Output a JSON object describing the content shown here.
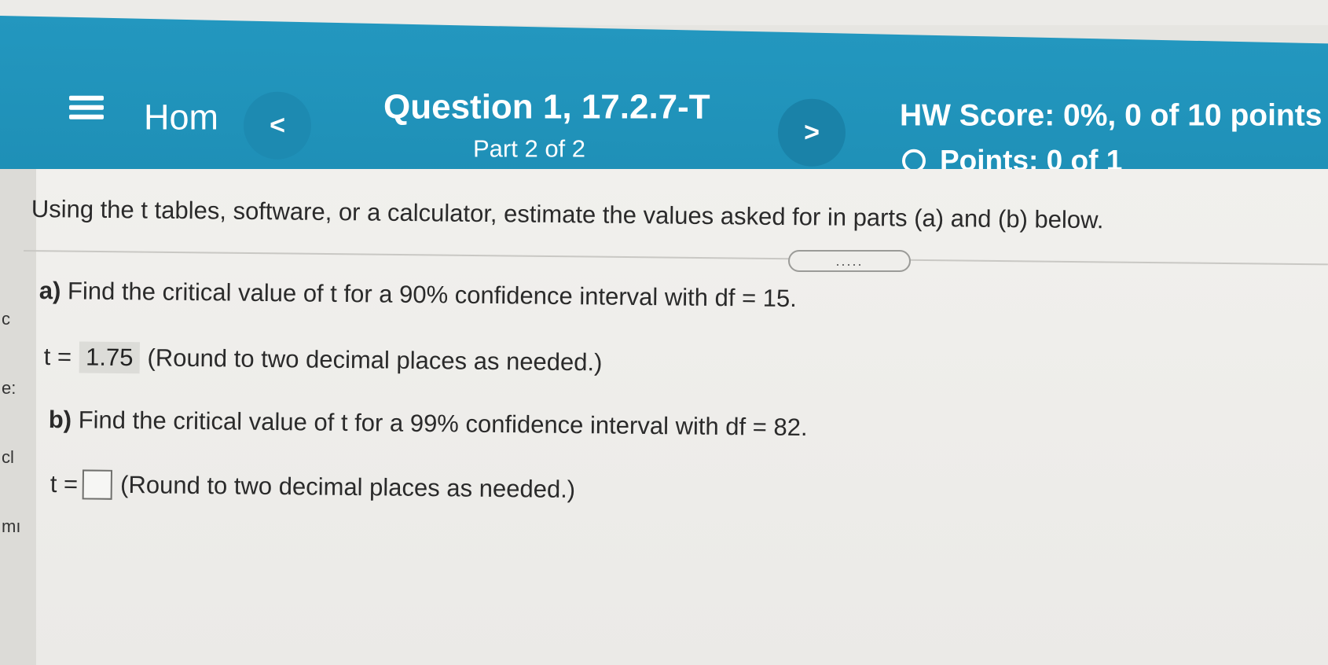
{
  "header": {
    "home_label": "Hom",
    "prev_label": "<",
    "next_label": ">",
    "question_title": "Question 1, 17.2.7-T",
    "question_part": "Part 2 of 2",
    "hw_score": "HW Score: 0%, 0 of 10 points",
    "points": "Points: 0 of 1"
  },
  "left_edge": [
    "c",
    "e:",
    "cl",
    "mı"
  ],
  "question": {
    "instructions": "Using the t tables, software, or a calculator, estimate the values asked for in parts (a) and (b) below.",
    "expand_label": ".....",
    "part_a": {
      "letter": "a)",
      "prompt": "Find the critical value of t for a 90% confidence interval with df = 15.",
      "answer_label": "t =",
      "answer_value": "1.75",
      "hint": "(Round to two decimal places as needed.)"
    },
    "part_b": {
      "letter": "b)",
      "prompt": "Find the critical value of t for a 99% confidence interval with df = 82.",
      "answer_label": "t =",
      "answer_value": "",
      "hint": "(Round to two decimal places as needed.)"
    }
  }
}
